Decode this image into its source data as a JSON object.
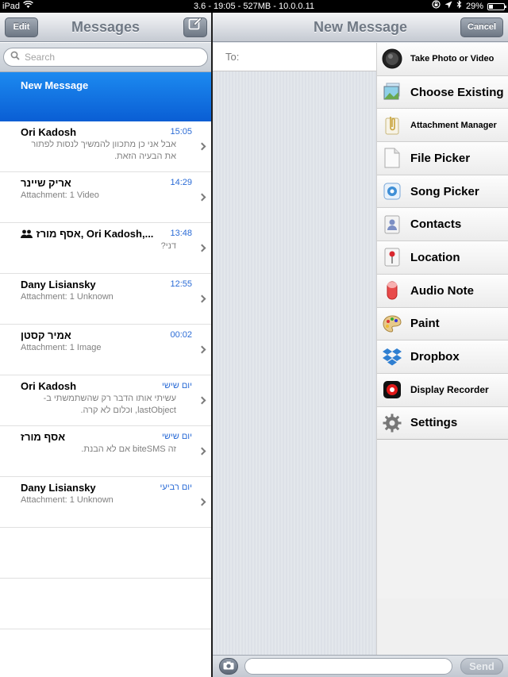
{
  "statusbar": {
    "device": "iPad",
    "center": "3.6 - 19:05 - 527MB - 10.0.0.11",
    "battery": "29%"
  },
  "left": {
    "title": "Messages",
    "edit_label": "Edit",
    "search_placeholder": "Search",
    "new_message_label": "New Message",
    "conversations": [
      {
        "name": "Ori Kadosh",
        "time": "15:05",
        "preview": "אבל אני כן מתכוון להמשיך לנסות לפתור את הבעיה הזאת.",
        "rtl": true
      },
      {
        "name": "אריק שיינר",
        "time": "14:29",
        "preview": "Attachment: 1 Video",
        "rtl": false
      },
      {
        "name": "אסף מורז, Ori Kadosh,...",
        "time": "13:48",
        "preview": "דני?",
        "rtl": true,
        "group": true
      },
      {
        "name": "Dany Lisiansky",
        "time": "12:55",
        "preview": "Attachment: 1 Unknown",
        "rtl": false
      },
      {
        "name": "אמיר קסטן",
        "time": "00:02",
        "preview": "Attachment: 1 Image",
        "rtl": false
      },
      {
        "name": "Ori Kadosh",
        "time": "יום שישי",
        "preview": "עשיתי אותו הדבר רק שהשתמשתי ב-lastObject, וכלום לא קרה.",
        "rtl": true
      },
      {
        "name": "אסף מורז",
        "time": "יום שישי",
        "preview": "זה biteSMS אם לא הבנת.",
        "rtl": true
      },
      {
        "name": "Dany Lisiansky",
        "time": "יום רביעי",
        "preview": "Attachment: 1 Unknown",
        "rtl": false
      }
    ]
  },
  "right": {
    "title": "New Message",
    "cancel_label": "Cancel",
    "to_label": "To:",
    "send_label": "Send",
    "menu": [
      {
        "label": "Take Photo or Video",
        "icon": "camera-icon"
      },
      {
        "label": "Choose Existing",
        "icon": "photos-icon"
      },
      {
        "label": "Attachment Manager",
        "icon": "paperclip-icon"
      },
      {
        "label": "File Picker",
        "icon": "file-icon"
      },
      {
        "label": "Song Picker",
        "icon": "music-icon"
      },
      {
        "label": "Contacts",
        "icon": "contacts-icon"
      },
      {
        "label": "Location",
        "icon": "location-pin-icon"
      },
      {
        "label": "Audio Note",
        "icon": "audio-note-icon"
      },
      {
        "label": "Paint",
        "icon": "palette-icon"
      },
      {
        "label": "Dropbox",
        "icon": "dropbox-icon"
      },
      {
        "label": "Display Recorder",
        "icon": "record-icon"
      },
      {
        "label": "Settings",
        "icon": "gear-icon"
      }
    ]
  }
}
